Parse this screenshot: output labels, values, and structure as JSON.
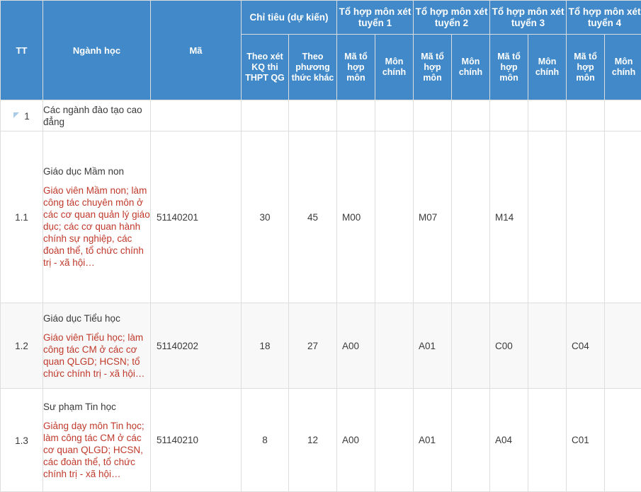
{
  "table": {
    "header": {
      "tt": "TT",
      "nganh_hoc": "Ngành học",
      "ma": "Mã",
      "chi_tieu_group": "Chỉ tiêu (dự kiến)",
      "chi_tieu_thpt": "Theo xét KQ thi THPT QG",
      "chi_tieu_khac": "Theo phương thức khác",
      "to_hop_1": "Tổ hợp môn xét tuyển 1",
      "to_hop_2": "Tổ hợp môn xét tuyển 2",
      "to_hop_3": "Tổ hợp môn xét tuyển 3",
      "to_hop_4": "Tổ hợp môn xét tuyển 4",
      "ma_to_hop_mon": "Mã tổ hợp môn",
      "mon_chinh": "Môn chính"
    },
    "rows": [
      {
        "type": "group",
        "tt": "1",
        "expander": "collapse-triangle-icon",
        "nganh_hoc": "Các ngành đào tạo cao đẳng",
        "nganh_desc": "",
        "ma": "",
        "chi_tieu_thpt": "",
        "chi_tieu_khac": "",
        "ma_to_hop_1": "",
        "mon_chinh_1": "",
        "ma_to_hop_2": "",
        "mon_chinh_2": "",
        "ma_to_hop_3": "",
        "mon_chinh_3": "",
        "ma_to_hop_4": "",
        "mon_chinh_4": ""
      },
      {
        "type": "item",
        "tt": "1.1",
        "nganh_hoc": "Giáo dục Mầm non",
        "nganh_desc": "Giáo viên Mầm non; làm công tác chuyên môn ở các cơ quan quản lý giáo dục; các cơ quan hành chính sự nghiệp, các đoàn thể, tổ chức chính trị - xã hội…",
        "ma": "51140201",
        "chi_tieu_thpt": "30",
        "chi_tieu_khac": "45",
        "ma_to_hop_1": "M00",
        "mon_chinh_1": "",
        "ma_to_hop_2": "M07",
        "mon_chinh_2": "",
        "ma_to_hop_3": "M14",
        "mon_chinh_3": "",
        "ma_to_hop_4": "",
        "mon_chinh_4": ""
      },
      {
        "type": "item",
        "tt": "1.2",
        "nganh_hoc": "Giáo dục Tiểu học",
        "nganh_desc": "Giáo viên Tiểu học; làm công tác CM ở các cơ quan QLGD; HCSN; tổ chức chính trị - xã hội…",
        "ma": "51140202",
        "chi_tieu_thpt": "18",
        "chi_tieu_khac": "27",
        "ma_to_hop_1": "A00",
        "mon_chinh_1": "",
        "ma_to_hop_2": "A01",
        "mon_chinh_2": "",
        "ma_to_hop_3": "C00",
        "mon_chinh_3": "",
        "ma_to_hop_4": "C04",
        "mon_chinh_4": ""
      },
      {
        "type": "item",
        "tt": "1.3",
        "nganh_hoc": "Sư phạm Tin học",
        "nganh_desc": "Giảng dạy môn Tin học; làm công tác CM ở các cơ quan QLGD; HCSN, các đoàn thể, tổ chức chính trị - xã hội…",
        "ma": "51140210",
        "chi_tieu_thpt": "8",
        "chi_tieu_khac": "12",
        "ma_to_hop_1": "A00",
        "mon_chinh_1": "",
        "ma_to_hop_2": "A01",
        "mon_chinh_2": "",
        "ma_to_hop_3": "A04",
        "mon_chinh_3": "",
        "ma_to_hop_4": "C01",
        "mon_chinh_4": ""
      }
    ]
  },
  "colors": {
    "header_blue": "#4189c8",
    "desc_red": "#c0392b",
    "grid_line": "#dddddd",
    "alt_row": "#f8f8f8",
    "triangle_blue": "#a9cbe8"
  }
}
